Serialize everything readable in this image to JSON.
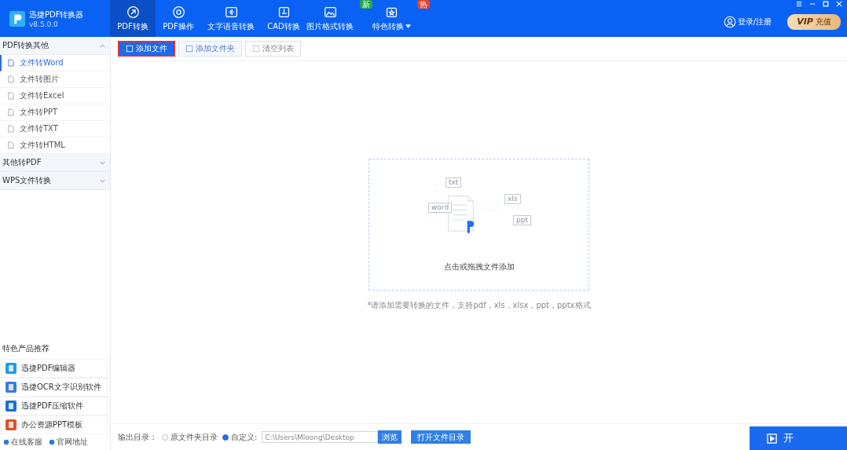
{
  "app": {
    "name": "迅捷PDF转换器",
    "version": "v8.5.0.0"
  },
  "nav": [
    {
      "label": "PDF转换",
      "selected": true
    },
    {
      "label": "PDF操作",
      "selected": false
    },
    {
      "label": "文字语音转换",
      "selected": false
    },
    {
      "label": "CAD转换",
      "selected": false
    },
    {
      "label": "图片格式转换",
      "selected": false,
      "badge": "新"
    },
    {
      "label": "特色转换",
      "selected": false,
      "badge": "热",
      "dropdown": true
    }
  ],
  "account": {
    "login": "登录/注册",
    "vip": "VIP",
    "vip_label": "充值"
  },
  "sidebar": {
    "groups": [
      {
        "label": "PDF转换其他",
        "expanded": true,
        "items": [
          {
            "label": "文件转Word",
            "selected": true
          },
          {
            "label": "文件转图片",
            "selected": false
          },
          {
            "label": "文件转Excel",
            "selected": false
          },
          {
            "label": "文件转PPT",
            "selected": false
          },
          {
            "label": "文件转TXT",
            "selected": false
          },
          {
            "label": "文件转HTML",
            "selected": false
          }
        ]
      },
      {
        "label": "其他转PDF",
        "expanded": false
      },
      {
        "label": "WPS文件转换",
        "expanded": false
      }
    ],
    "recommend_title": "特色产品推荐",
    "products": [
      {
        "label": "迅捷PDF编辑器",
        "color": "#1e9be8"
      },
      {
        "label": "迅捷OCR文字识别软件",
        "color": "#3a7be0"
      },
      {
        "label": "迅捷PDF压缩软件",
        "color": "#1a6fd0"
      },
      {
        "label": "办公资源PPT模板",
        "color": "#d9532b"
      }
    ],
    "footer_links": [
      "在线客服",
      "官网地址"
    ]
  },
  "toolbar": [
    {
      "label": "添加文件",
      "kind": "primary"
    },
    {
      "label": "添加文件夹",
      "kind": "secondary"
    },
    {
      "label": "清空列表",
      "kind": "disabled"
    }
  ],
  "dropzone": {
    "tags": [
      "txt",
      "word",
      "xls",
      "ppt"
    ],
    "prompt": "点击或拖拽文件添加",
    "hint": "*请添加需要转换的文件，支持pdf，xls，xlsx，ppt，pptx格式"
  },
  "output": {
    "label": "输出目录：",
    "options": [
      {
        "label": "原文件夹目录",
        "selected": false
      },
      {
        "label": "自定义:",
        "selected": true
      }
    ],
    "path": "C:\\Users\\Mloong\\Desktop",
    "browse": "浏览",
    "open": "打开文件目录"
  },
  "start_button": "开"
}
